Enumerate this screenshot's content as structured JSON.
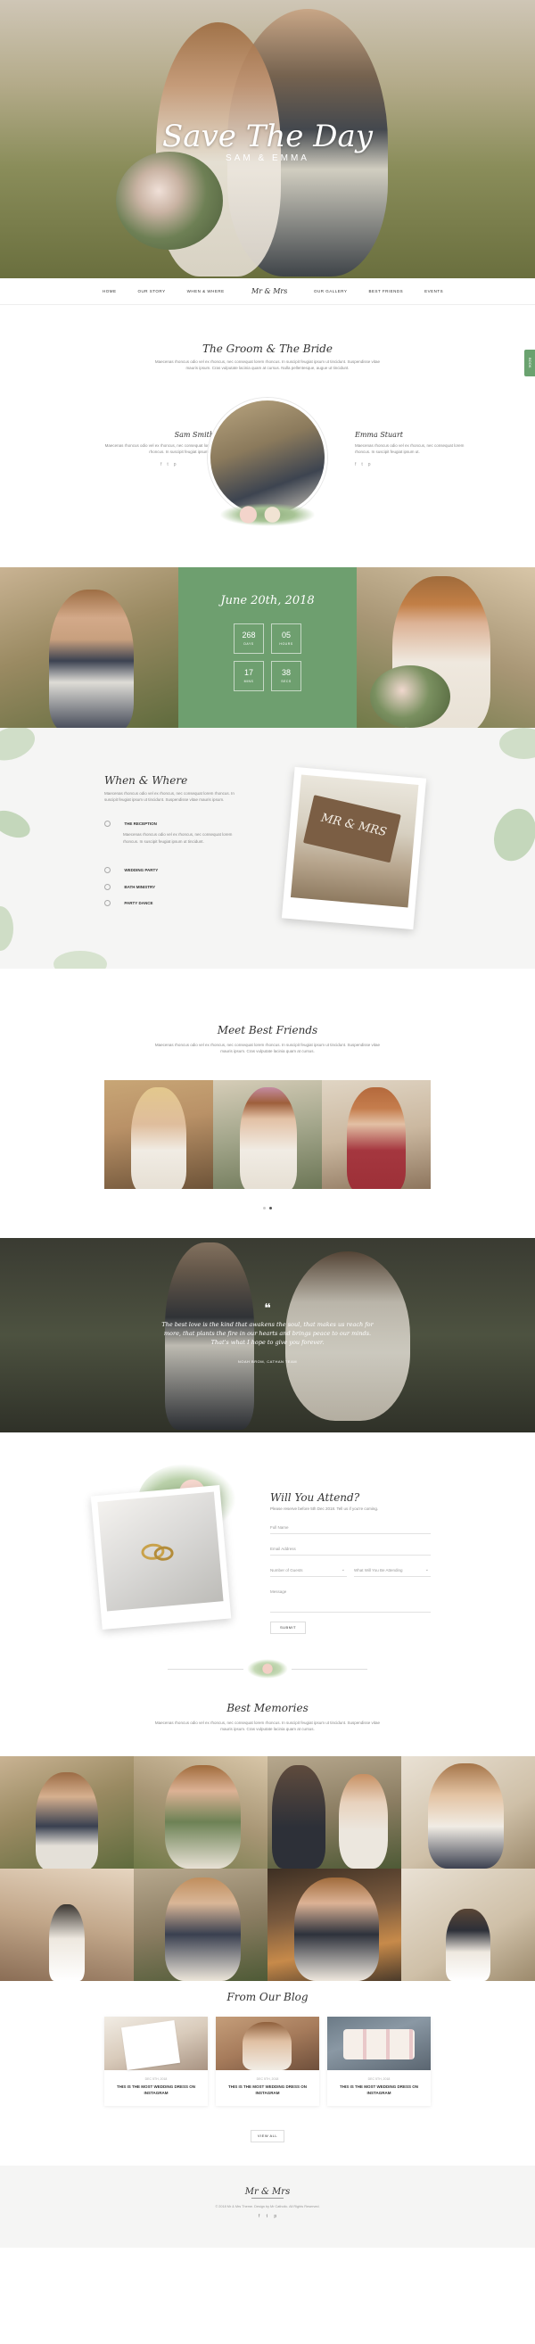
{
  "hero": {
    "title": "Save The Day",
    "subtitle": "SAM & EMMA"
  },
  "nav": {
    "items_left": [
      "HOME",
      "OUR STORY",
      "WHEN & WHERE"
    ],
    "logo": "Mr & Mrs",
    "items_right": [
      "OUR GALLERY",
      "BEST FRIENDS",
      "EVENTS"
    ]
  },
  "couple": {
    "title": "The Groom & The Bride",
    "text": "Maecenas rhoncus odio vel ex rhoncus, nec consequat lorem rhoncus. In suscipit feugiat ipsum ut tincidunt. Suspendisse vitae mauris ipsum. Cras vulputate lacinia quam at cursus. Nulla pellentesque, augue ut tincidunt.",
    "groom": {
      "name": "Sam Smith",
      "text": "Maecenas rhoncus odio vel ex rhoncus, nec consequat lorem rhoncus. In suscipit feugiat ipsum ut."
    },
    "bride": {
      "name": "Emma Stuart",
      "text": "Maecenas rhoncus odio vel ex rhoncus, nec consequat lorem rhoncus. In suscipit feugiat ipsum ut."
    },
    "social": [
      "f",
      "t",
      "p"
    ]
  },
  "side_tab": "BOOK",
  "countdown": {
    "date": "June 20th, 2018",
    "items": [
      {
        "value": "268",
        "label": "DAYS"
      },
      {
        "value": "05",
        "label": "HOURS"
      },
      {
        "value": "17",
        "label": "MINS"
      },
      {
        "value": "38",
        "label": "SECS"
      }
    ]
  },
  "when_where": {
    "title": "When & Where",
    "text": "Maecenas rhoncus odio vel ex rhoncus, nec consequat lorem rhoncus. In suscipit feugiat ipsum ut tincidunt. Suspendisse vitae mauris ipsum.",
    "events": [
      {
        "name": "THE RECEPTION",
        "text": "Maecenas rhoncus odio vel ex rhoncus, nec consequat lorem rhoncus. In suscipit feugiat ipsum ut tincidunt."
      },
      {
        "name": "WEDDING PARTY",
        "text": ""
      },
      {
        "name": "BATH MINISTRY",
        "text": ""
      },
      {
        "name": "PARTY DANCE",
        "text": ""
      }
    ],
    "photo_caption": "MR & MRS"
  },
  "friends": {
    "title": "Meet Best Friends",
    "text": "Maecenas rhoncus odio vel ex rhoncus, nec consequat lorem rhoncus. In suscipit feugiat ipsum ut tincidunt. Suspendisse vitae mauris ipsum. Cras vulputate lacinia quam at cursus."
  },
  "quote": {
    "mark": "❝",
    "text": "The best love is the kind that awakens the soul, that makes us reach for more, that plants the fire in our hearts and brings peace to our minds. That's what I hope to give you forever.",
    "author": "NOAH BROM, CATHAN TEAM"
  },
  "rsvp": {
    "title": "Will You Attend?",
    "text": "Please reserve before 5th Dec 2018. Tell us if you're coming.",
    "fields": [
      "Full Name",
      "Email Address"
    ],
    "select_guests": "Number of Guests",
    "select_event": "What Will You Be Attending",
    "message": "Message",
    "submit": "SUBMIT"
  },
  "memories": {
    "title": "Best Memories",
    "text": "Maecenas rhoncus odio vel ex rhoncus, nec consequat lorem rhoncus. In suscipit feugiat ipsum ut tincidunt. Suspendisse vitae mauris ipsum. Cras vulputate lacinia quam at cursus."
  },
  "blog": {
    "title": "From Our Blog",
    "posts": [
      {
        "date": "DEC 5TH, 2018",
        "title": "THIS IS THE MOST WEDDING DRESS ON INSTAGRAM"
      },
      {
        "date": "DEC 5TH, 2018",
        "title": "THIS IS THE MOST WEDDING DRESS ON INSTAGRAM"
      },
      {
        "date": "DEC 5TH, 2018",
        "title": "THIS IS THE MOST WEDDING DRESS ON INSTAGRAM"
      }
    ],
    "view_all": "VIEW ALL"
  },
  "footer": {
    "logo": "Mr & Mrs",
    "copyright": "© 2018 Mr & Mrs Theme. Design by Mr Catholic. All Rights Reserved.",
    "social": [
      "f",
      "t",
      "p"
    ]
  },
  "colors": {
    "accent": "#6aa26f",
    "green_panel": "#6e9f6f",
    "text": "#333333"
  }
}
